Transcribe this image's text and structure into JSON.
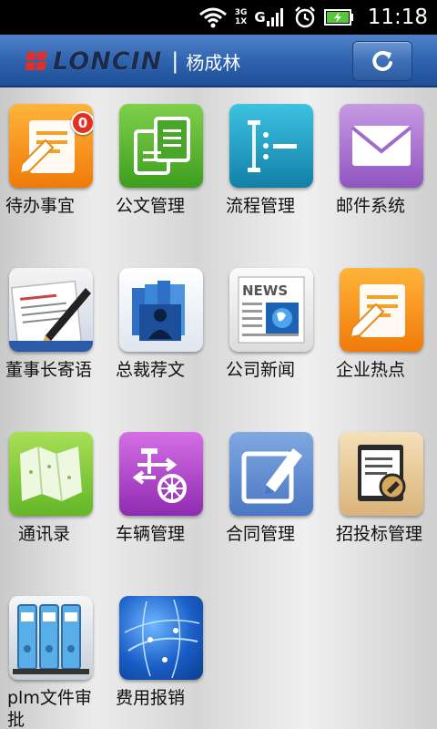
{
  "status_bar": {
    "network_type_top": "3G",
    "network_type_bottom": "1X",
    "signal_label": "G",
    "time": "11:18",
    "icons": [
      "wifi-icon",
      "mobile-data-icon",
      "signal-icon",
      "alarm-icon",
      "battery-charging-icon"
    ]
  },
  "header": {
    "logo_text": "LONCIN",
    "separator": "|",
    "user_name": "杨成林",
    "refresh_icon": "refresh-icon"
  },
  "colors": {
    "header_blue": "#2f64b0",
    "badge_red": "#e53020"
  },
  "apps": [
    {
      "label": "待办事宜",
      "icon": "todo-icon",
      "badge": "0"
    },
    {
      "label": "公文管理",
      "icon": "documents-icon"
    },
    {
      "label": "流程管理",
      "icon": "workflow-icon"
    },
    {
      "label": "邮件系统",
      "icon": "mail-icon"
    },
    {
      "label": "董事长寄语",
      "icon": "chairman-message-icon"
    },
    {
      "label": "总裁荐文",
      "icon": "president-books-icon"
    },
    {
      "label": "公司新闻",
      "icon": "news-icon"
    },
    {
      "label": "企业热点",
      "icon": "hot-topics-icon"
    },
    {
      "label": "通讯录",
      "icon": "contacts-map-icon"
    },
    {
      "label": "车辆管理",
      "icon": "vehicle-icon"
    },
    {
      "label": "合同管理",
      "icon": "contract-icon"
    },
    {
      "label": "招投标管理",
      "icon": "bidding-icon"
    },
    {
      "label": "plm文件审批",
      "icon": "plm-binders-icon"
    },
    {
      "label": "费用报销",
      "icon": "expense-globe-icon"
    }
  ]
}
